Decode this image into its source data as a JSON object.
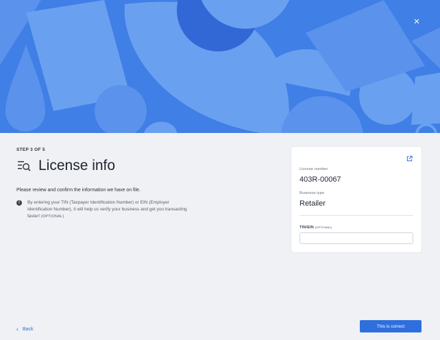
{
  "hero": {
    "background_color": "#3f7fe6",
    "shape_color": "#6aa0f0",
    "close_icon": "close-icon",
    "close_glyph": "×"
  },
  "step": {
    "label": "STEP 3 OF 5"
  },
  "page": {
    "title": "License info",
    "title_icon": "document-search-icon",
    "description": "Please review and confirm the information we have on file.",
    "info_icon": "info-icon",
    "info_glyph": "!",
    "info_text": "By entering your TIN (Taxpayer Identification Number) or EIN (Employer Identification Number), it will help us verify your business and get you transacting faster!",
    "info_optional": "(OPTIONAL)"
  },
  "card": {
    "edit_icon": "external-edit-icon",
    "license_number_label": "License number",
    "license_number_value": "403R-00067",
    "business_type_label": "Business type",
    "business_type_value": "Retailer",
    "tin_label": "TIN/EIN",
    "tin_optional": "(OPTIONAL)",
    "tin_value": "",
    "tin_placeholder": ""
  },
  "footer": {
    "back_icon": "chevron-left-icon",
    "back_glyph": "‹",
    "back_label": "Back",
    "confirm_label": "This is correct"
  },
  "colors": {
    "accent": "#2f6fdd",
    "page_bg": "#eff1f4"
  }
}
